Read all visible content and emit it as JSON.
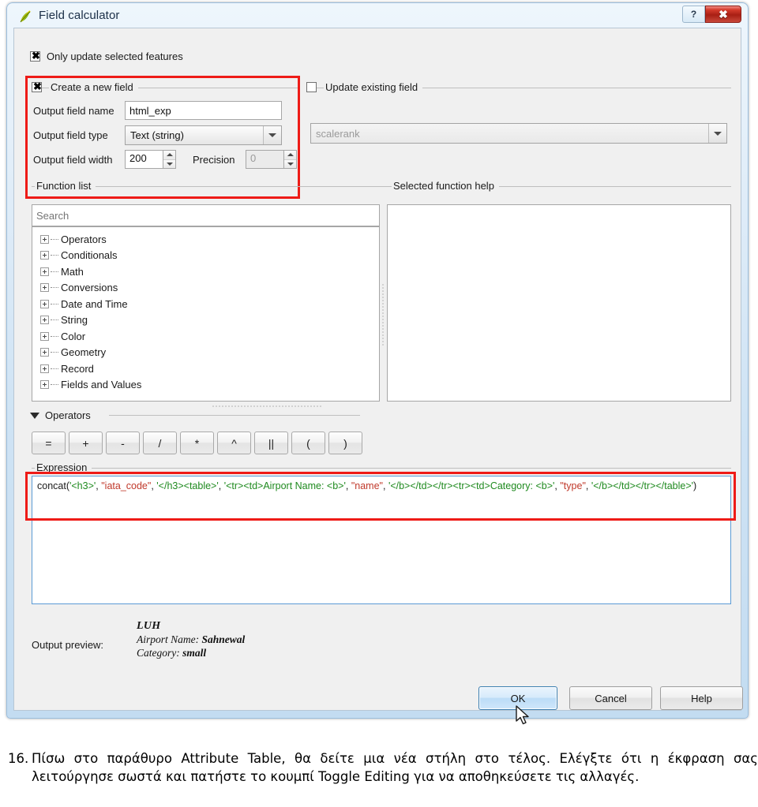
{
  "window": {
    "title": "Field calculator",
    "icon": "qgis-leaf-icon",
    "help_button": "?",
    "close_button": "✖"
  },
  "options": {
    "only_update_selected": {
      "label": "Only update selected features",
      "checked": true
    },
    "create_new_field": {
      "label": "Create a new field",
      "checked": true
    },
    "update_existing_field": {
      "label": "Update existing field",
      "checked": false
    }
  },
  "new_field": {
    "name_label": "Output field name",
    "name_value": "html_exp",
    "type_label": "Output field type",
    "type_value": "Text (string)",
    "width_label": "Output field width",
    "width_value": "200",
    "precision_label": "Precision",
    "precision_value": "0"
  },
  "existing_field": {
    "selected_value": "scalerank"
  },
  "function_list": {
    "group_title": "Function list",
    "search_placeholder": "Search",
    "search_value": "",
    "items": [
      "Operators",
      "Conditionals",
      "Math",
      "Conversions",
      "Date and Time",
      "String",
      "Color",
      "Geometry",
      "Record",
      "Fields and Values"
    ]
  },
  "help_panel": {
    "group_title": "Selected function help",
    "content": ""
  },
  "operators": {
    "section_label": "Operators",
    "buttons": [
      "=",
      "+",
      "-",
      "/",
      "*",
      "^",
      "||",
      "(",
      ")"
    ]
  },
  "expression": {
    "group_title": "Expression",
    "tokens": [
      {
        "t": "plain",
        "v": "concat("
      },
      {
        "t": "str",
        "v": "'<h3>'"
      },
      {
        "t": "plain",
        "v": ", "
      },
      {
        "t": "fld",
        "v": "\"iata_code\""
      },
      {
        "t": "plain",
        "v": ", "
      },
      {
        "t": "str",
        "v": "'</h3><table>'"
      },
      {
        "t": "plain",
        "v": ", "
      },
      {
        "t": "str",
        "v": "'<tr><td>Airport Name: <b>'"
      },
      {
        "t": "plain",
        "v": ", "
      },
      {
        "t": "fld",
        "v": "\"name\""
      },
      {
        "t": "plain",
        "v": ", "
      },
      {
        "t": "str",
        "v": "'</b></td></tr><tr><td>Category: <b>'"
      },
      {
        "t": "plain",
        "v": ", "
      },
      {
        "t": "fld",
        "v": "\"type\""
      },
      {
        "t": "plain",
        "v": ", "
      },
      {
        "t": "str",
        "v": "'</b></td></tr></table>'"
      },
      {
        "t": "plain",
        "v": ")"
      }
    ],
    "plain_text": "concat('<h3>', \"iata_code\", '</h3><table>', '<tr><td>Airport Name: <b>', \"name\", '</b></td></tr><tr><td>Category: <b>', \"type\", '</b></td></tr></table>')"
  },
  "preview": {
    "label": "Output preview:",
    "heading": "LUH",
    "rows": [
      {
        "key": "Airport Name:",
        "value": "Sahnewal"
      },
      {
        "key": "Category:",
        "value": "small"
      }
    ]
  },
  "buttons": {
    "ok": "OK",
    "cancel": "Cancel",
    "help": "Help"
  },
  "caption": {
    "number": "16.",
    "text": "Πίσω στο παράθυρο Attribute Table, θα δείτε μια νέα στήλη στο τέλος. Ελέγξτε ότι η έκφραση σας λειτούργησε σωστά και πατήστε το κουμπί Toggle Editing για να αποθηκεύσετε τις αλλαγές."
  },
  "colors": {
    "highlight_red": "#ee1b17",
    "focus_blue": "#5b9bd5",
    "string_token": "#1f8a1f",
    "field_token": "#c0392b",
    "title_close": "#a81f14"
  }
}
